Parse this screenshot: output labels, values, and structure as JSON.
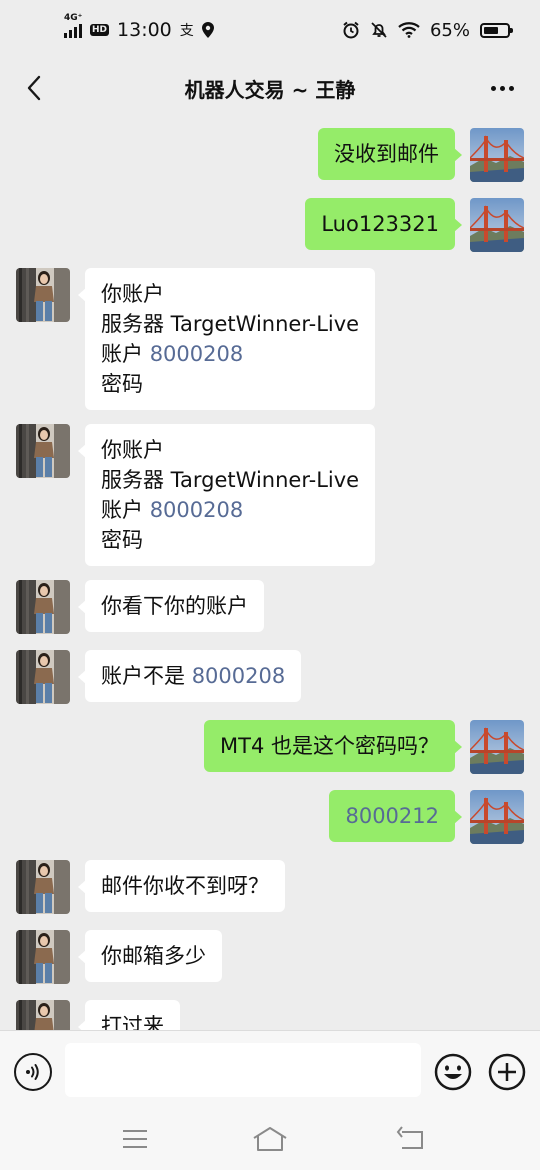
{
  "status_bar": {
    "network": "4G⁺",
    "hd": "HD",
    "time": "13:00",
    "app_badge": "支",
    "battery_text": "65%",
    "battery_level": 0.65
  },
  "header": {
    "title": "机器人交易 ~ 王静"
  },
  "messages": [
    {
      "side": "out",
      "lines": [
        "没收到邮件"
      ]
    },
    {
      "side": "out",
      "lines": [
        "Luo123321"
      ]
    },
    {
      "side": "in",
      "lines": [
        "你账户",
        "服务器 TargetWinner-Live",
        "账户 8000208",
        "密码"
      ]
    },
    {
      "side": "in",
      "lines": [
        "你账户",
        "服务器 TargetWinner-Live",
        "账户 8000208",
        "密码"
      ]
    },
    {
      "side": "in",
      "lines": [
        "你看下你的账户"
      ]
    },
    {
      "side": "in",
      "lines": [
        "账户不是 8000208"
      ]
    },
    {
      "side": "out",
      "lines": [
        "MT4 也是这个密码吗？"
      ]
    },
    {
      "side": "out",
      "lines": [
        "8000212"
      ]
    },
    {
      "side": "in",
      "lines": [
        "邮件你收不到呀？"
      ]
    },
    {
      "side": "in",
      "lines": [
        "你邮箱多少"
      ]
    },
    {
      "side": "in",
      "lines": [
        "打过来"
      ]
    }
  ],
  "input": {
    "value": "",
    "placeholder": ""
  },
  "icons": {
    "back": "chevron-left-icon",
    "more": "more-dots-icon",
    "voice": "voice-icon",
    "emoji": "emoji-icon",
    "plus": "plus-icon",
    "menu": "menu-icon",
    "home": "home-icon",
    "return": "return-icon"
  },
  "colors": {
    "background": "#ededed",
    "outgoing_bubble": "#95ec69",
    "incoming_bubble": "#ffffff",
    "number_link": "#576b95"
  }
}
